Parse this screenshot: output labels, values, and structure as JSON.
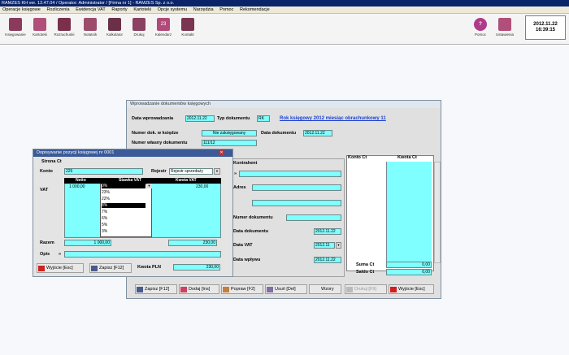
{
  "app": {
    "title": "RAMZES KH ver. 12.47.04 / Operator: Administrator / [Firma nr 1] - RAMZES Sp. z o.o."
  },
  "menu": [
    "Operacje księgowe",
    "Rozliczenia",
    "Ewidencja VAT",
    "Raporty",
    "Kartoteki",
    "Opcje systemu",
    "Narzędzia",
    "Pomoc",
    "Rekomendacje"
  ],
  "toolbar": {
    "items": [
      "Księgowanie",
      "Kartoteki",
      "Rozrachunki",
      "Notatnik",
      "Kalkulator",
      "Drukuj",
      "Kalendarz",
      "Kontakt"
    ],
    "help": "Pomoc",
    "settings": "Ustawienia"
  },
  "clock": {
    "date": "2012.11.22",
    "time": "16:39:15"
  },
  "doc_window": {
    "title": "Wprowadzanie dokumentów księgowych",
    "data_wprowadzania_label": "Data wprowadzania",
    "data_wprowadzania": "2012.11.22",
    "typ_label": "Typ dokumentu",
    "typ": "RK",
    "rok_link": "Rok księgowy 2012 miesiąc obrachunkowy 11",
    "nr_ksiedze_label": "Numer dok. w księdze",
    "nr_ksiedze": "Nie zaksięgowany",
    "data_dok_label": "Data dokumentu",
    "data_dok": "2012.11.22",
    "nr_wlasny_label": "Numer własny dokumentu",
    "nr_wlasny": "111/12",
    "kontrahent_label": "Kontrahent",
    "adres_label": "Adres",
    "nr_dok_label": "Numer dokumentu",
    "data_dokumentu_label": "Data dokumentu",
    "data_dokumentu": "2012.11.22",
    "data_vat_label": "Data VAT",
    "data_vat": "2012.11",
    "data_wplywu_label": "Data wpływu",
    "data_wplywu": "2012.11.22",
    "konto_ct_header": "Konto Ct",
    "kwota_ct_header": "Kwota Ct",
    "suma_ct_label": "Suma Ct",
    "suma_ct": "0,00",
    "saldo_ct_label": "Saldo Ct",
    "saldo_ct": "0,00",
    "buttons": {
      "zapisz": "Zapisz [F12]",
      "dodaj": "Dodaj [Ins]",
      "popraw": "Popraw [F2]",
      "usun": "Usuń [Del]",
      "wzory": "Wzory",
      "drukuj": "Drukuj [F9]",
      "wyjscie": "Wyjście [Esc]"
    }
  },
  "posting_window": {
    "title": "Dopisywanie pozycji księgowej nr 0001",
    "strona": "Strona Ct",
    "konto_label": "Konto",
    "konto": "225",
    "rejestr_label": "Rejestr",
    "rejestr": "Rejestr sprzedaży",
    "vat_label": "VAT",
    "cols": [
      "Netto",
      "Stawka VAT",
      "Kwota VAT"
    ],
    "netto": "1 000,00",
    "stawka": "0%",
    "kwota_vat": "230,00",
    "rates": [
      "0%",
      "23%",
      "22%",
      "8%",
      "7%",
      "6%",
      "5%",
      "3%"
    ],
    "selected_rate_index": 3,
    "razem_label": "Razem",
    "razem_netto": "1 000,00",
    "razem_vat": "230,00",
    "opis_label": "Opis",
    "kwota_pln_label": "Kwota PLN",
    "kwota_pln": "230,00",
    "wyjscie": "Wyjście [Esc]",
    "zapisz": "Zapisz [F12]"
  }
}
